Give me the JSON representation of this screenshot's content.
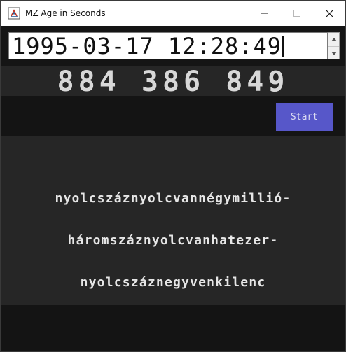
{
  "window": {
    "title": "MZ Age in Seconds",
    "controls": {
      "minimize": "minimize",
      "maximize": "maximize",
      "close": "close"
    }
  },
  "date_input": {
    "value": "1995-03-17 12:28:49"
  },
  "seconds": {
    "value": "884 386 849"
  },
  "start_button": {
    "label": "Start",
    "color": "#5757c9"
  },
  "words": {
    "lines": [
      "nyolcszáznyolcvannégymillió-",
      "háromszáznyolcvanhatezer-",
      "nyolcszáznegyvenkilenc"
    ]
  },
  "icons": {
    "app": "java-app-icon",
    "spinner_up": "triangle-up-icon",
    "spinner_down": "triangle-down-icon"
  }
}
